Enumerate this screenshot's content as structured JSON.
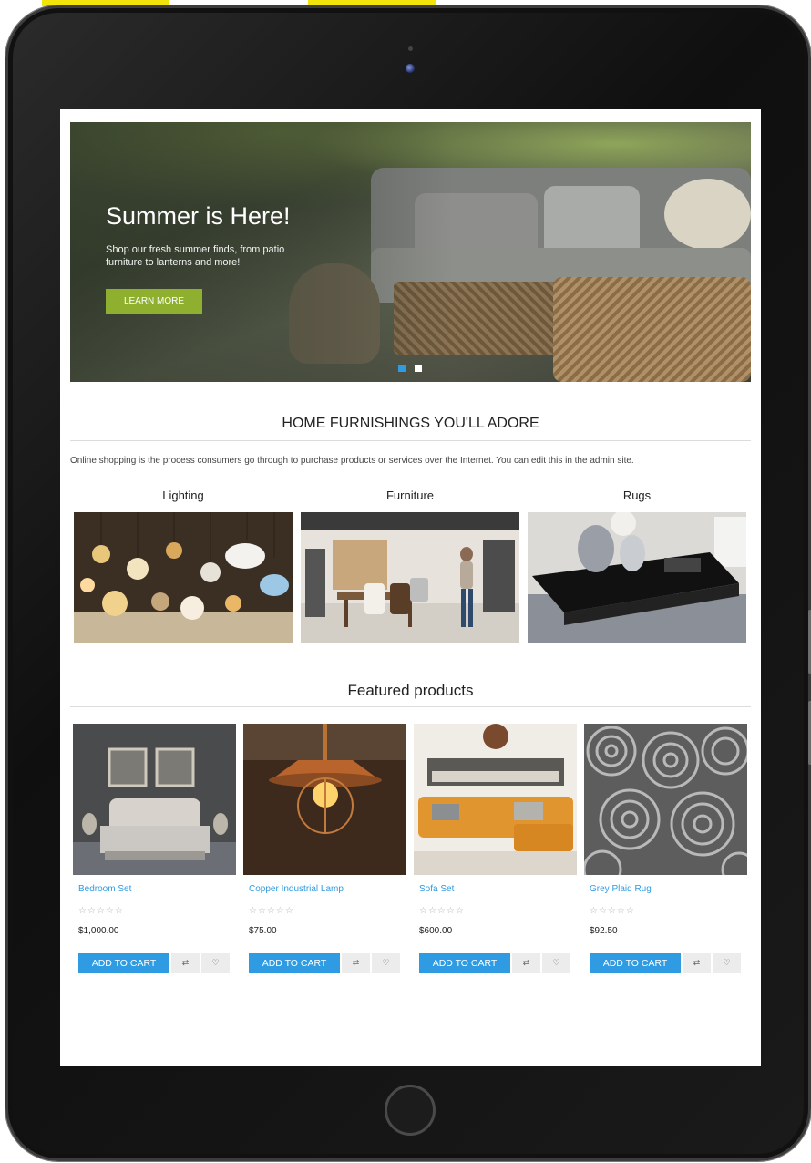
{
  "hero": {
    "title": "Summer is Here!",
    "subtitle": "Shop our fresh summer finds, from patio furniture to lanterns and more!",
    "button_label": "LEARN MORE",
    "slides_total": 2,
    "slide_active": 1
  },
  "furnishings": {
    "title": "HOME FURNISHINGS YOU'LL ADORE",
    "intro": "Online shopping is the process consumers go through to purchase products or services over the Internet. You can edit this in the admin site."
  },
  "categories": [
    {
      "label": "Lighting"
    },
    {
      "label": "Furniture"
    },
    {
      "label": "Rugs"
    }
  ],
  "featured": {
    "title": "Featured products",
    "products": [
      {
        "name": "Bedroom Set",
        "stars": "☆☆☆☆☆",
        "price": "$1,000.00",
        "cart_label": "ADD TO CART"
      },
      {
        "name": "Copper Industrial Lamp",
        "stars": "☆☆☆☆☆",
        "price": "$75.00",
        "cart_label": "ADD TO CART"
      },
      {
        "name": "Sofa Set",
        "stars": "☆☆☆☆☆",
        "price": "$600.00",
        "cart_label": "ADD TO CART"
      },
      {
        "name": "Grey Plaid Rug",
        "stars": "☆☆☆☆☆",
        "price": "$92.50",
        "cart_label": "ADD TO CART"
      }
    ]
  },
  "icons": {
    "compare": "compare-icon",
    "wishlist": "heart-icon"
  },
  "colors": {
    "accent_blue": "#2e9be2",
    "hero_button": "#8fb02f",
    "deco_yellow": "#f2e30a"
  }
}
